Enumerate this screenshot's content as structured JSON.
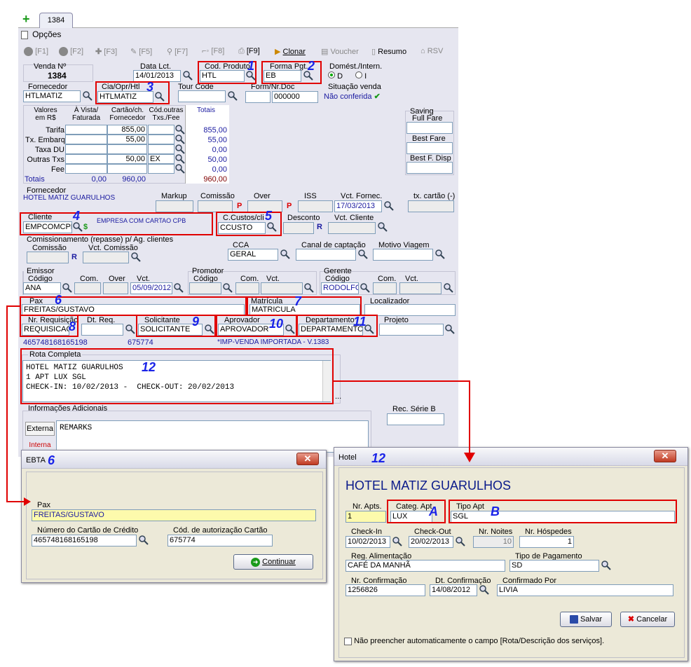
{
  "tab": {
    "label": "1384"
  },
  "menu": {
    "options": "Opções"
  },
  "toolbar": {
    "f1": "[F1]",
    "f2": "[F2]",
    "f3": "[F3]",
    "f5": "[F5]",
    "f7": "[F7]",
    "f8": "[F8]",
    "f9": "[F9]",
    "clone": "Clonar",
    "voucher": "Voucher",
    "summary": "Resumo",
    "rsv": "RSV"
  },
  "sale": {
    "label": "Venda Nº",
    "number": "1384",
    "date_label": "Data Lct.",
    "date": "14/01/2013",
    "product_label": "Cod. Produto",
    "product": "HTL",
    "payment_label": "Forma Pgt.",
    "payment": "EB",
    "dom_label": "Domést./Intern.",
    "dom_d": "D",
    "dom_i": "I"
  },
  "supplier": {
    "label": "Fornecedor",
    "value": "HTLMATIZ",
    "cia_label": "Cia/Opr/Htl",
    "cia": "HTLMATIZ",
    "tour_label": "Tour Code",
    "tour": "",
    "form_label": "Form/Nr.Doc",
    "form": "",
    "doc": "000000",
    "status_label": "Situação venda",
    "status": "Não conferida"
  },
  "values": {
    "h_values": "Valores",
    "h_values2": "em R$",
    "h_cash": "À Vista/",
    "h_cash2": "Faturada",
    "h_card": "Cartão/ch.",
    "h_card2": "Fornecedor",
    "h_codes": "Cód.outras",
    "h_codes2": "Txs./Fee",
    "h_totals": "Totais",
    "rows": [
      {
        "label": "Tarifa",
        "cash": "",
        "card": "855,00",
        "code": "",
        "total": "855,00"
      },
      {
        "label": "Tx. Embarq.",
        "cash": "",
        "card": "55,00",
        "code": "",
        "total": "55,00"
      },
      {
        "label": "Taxa DU",
        "cash": "",
        "card": "",
        "code": "",
        "total": "0,00"
      },
      {
        "label": "Outras Txs",
        "cash": "",
        "card": "50,00",
        "code": "EX",
        "total": "50,00"
      },
      {
        "label": "Fee",
        "cash": "",
        "card": "",
        "code": "",
        "total": "0,00"
      }
    ],
    "totals_label": "Totais",
    "totals_cash": "0,00",
    "totals_card": "960,00",
    "totals_total": "960,00"
  },
  "saving": {
    "label": "Saving",
    "full_fare": "Full Fare",
    "best_fare": "Best Fare",
    "best_disp": "Best F. Disp"
  },
  "forn2": {
    "label": "Fornecedor",
    "name": "HOTEL MATIZ GUARULHOS",
    "markup": "Markup",
    "commission": "Comissão",
    "over": "Over",
    "iss": "ISS",
    "vct_label": "Vct. Fornec.",
    "vct": "17/03/2013",
    "card_tax": "tx. cartão (-)",
    "p": "P"
  },
  "client": {
    "label": "Cliente",
    "value": "EMPCOMCPB",
    "name": "EMPRESA COM CARTAO CPB",
    "cost_label": "C.Custos/cli",
    "cost": "CCUSTO",
    "discount": "Desconto",
    "vct_label": "Vct. Cliente",
    "r": "R"
  },
  "comm": {
    "label": "Comissionamento (repasse) p/ Ag. clientes",
    "commission": "Comissão",
    "vct": "Vct. Comissão",
    "r": "R",
    "cca_label": "CCA",
    "cca": "GERAL",
    "canal": "Canal de captação",
    "motivo": "Motivo Viagem"
  },
  "emissor": {
    "label": "Emissor",
    "code_label": "Código",
    "code": "ANA",
    "com": "Com.",
    "over": "Over",
    "vct_label": "Vct.",
    "vct": "05/09/2012"
  },
  "promotor": {
    "label": "Promotor",
    "code_label": "Código",
    "com": "Com.",
    "vct": "Vct."
  },
  "gerente": {
    "label": "Gerente",
    "code_label": "Código",
    "code": "RODOLFO",
    "com": "Com.",
    "vct": "Vct."
  },
  "pax": {
    "label": "Pax",
    "value": "FREITAS/GUSTAVO",
    "mat_label": "Matrícula",
    "mat": "MATRICULA",
    "loc_label": "Localizador"
  },
  "req": {
    "label": "Nr. Requisição",
    "value": "REQUISICAO",
    "dt_label": "Dt. Req.",
    "sol_label": "Solicitante",
    "sol": "SOLICITANTE",
    "apr_label": "Aprovador",
    "apr": "APROVADOR",
    "dep_label": "Departamento",
    "dep": "DEPARTAMENTO",
    "proj_label": "Projeto"
  },
  "info": {
    "card": "465748168165198",
    "auth": "675774",
    "imp": "*IMP-VENDA IMPORTADA - V.1383"
  },
  "rota": {
    "label": "Rota Completa",
    "text": "HOTEL MATIZ GUARULHOS\n1 APT LUX SGL\nCHECK-IN: 10/02/2013 -  CHECK-OUT: 20/02/2013",
    "dots": "..."
  },
  "addl": {
    "label": "Informações Adicionais",
    "ext": "Externa",
    "int": "Interna",
    "text": "REMARKS",
    "rec_label": "Rec. Série B"
  },
  "markers": {
    "m1": "1",
    "m2": "2",
    "m3": "3",
    "m4": "4",
    "m5": "5",
    "m6": "6",
    "m7": "7",
    "m8": "8",
    "m9": "9",
    "m10": "10",
    "m11": "11",
    "m12": "12",
    "mA": "A",
    "mB": "B"
  },
  "ebta": {
    "title": "EBTA",
    "pax_label": "Pax",
    "pax": "FREITAS/GUSTAVO",
    "card_label": "Número do Cartão de Crédito",
    "card": "465748168165198",
    "auth_label": "Cód. de autorização Cartão",
    "auth": "675774",
    "continue": "Continuar"
  },
  "hotel": {
    "title": "Hotel",
    "name": "HOTEL MATIZ GUARULHOS",
    "apts_label": "Nr. Apts.",
    "apts": "1",
    "cat_label": "Categ. Apt",
    "cat": "LUX",
    "tipo_label": "Tipo Apt",
    "tipo": "SGL",
    "checkin_label": "Check-In",
    "checkin": "10/02/2013",
    "checkout_label": "Check-Out",
    "checkout": "20/02/2013",
    "nights_label": "Nr. Noites",
    "nights": "10",
    "guests_label": "Nr. Hóspedes",
    "guests": "1",
    "meal_label": "Reg. Alimentação",
    "meal": "CAFÉ DA MANHÃ",
    "paytype_label": "Tipo de Pagamento",
    "paytype": "SD",
    "conf_label": "Nr. Confirmação",
    "conf": "1256826",
    "confdt_label": "Dt. Confirmação",
    "confdt": "14/08/2012",
    "confby_label": "Confirmado Por",
    "confby": "LIVIA",
    "save": "Salvar",
    "cancel": "Cancelar",
    "checkbox": "Não preencher automaticamente o campo [Rota/Descrição dos serviços]."
  }
}
